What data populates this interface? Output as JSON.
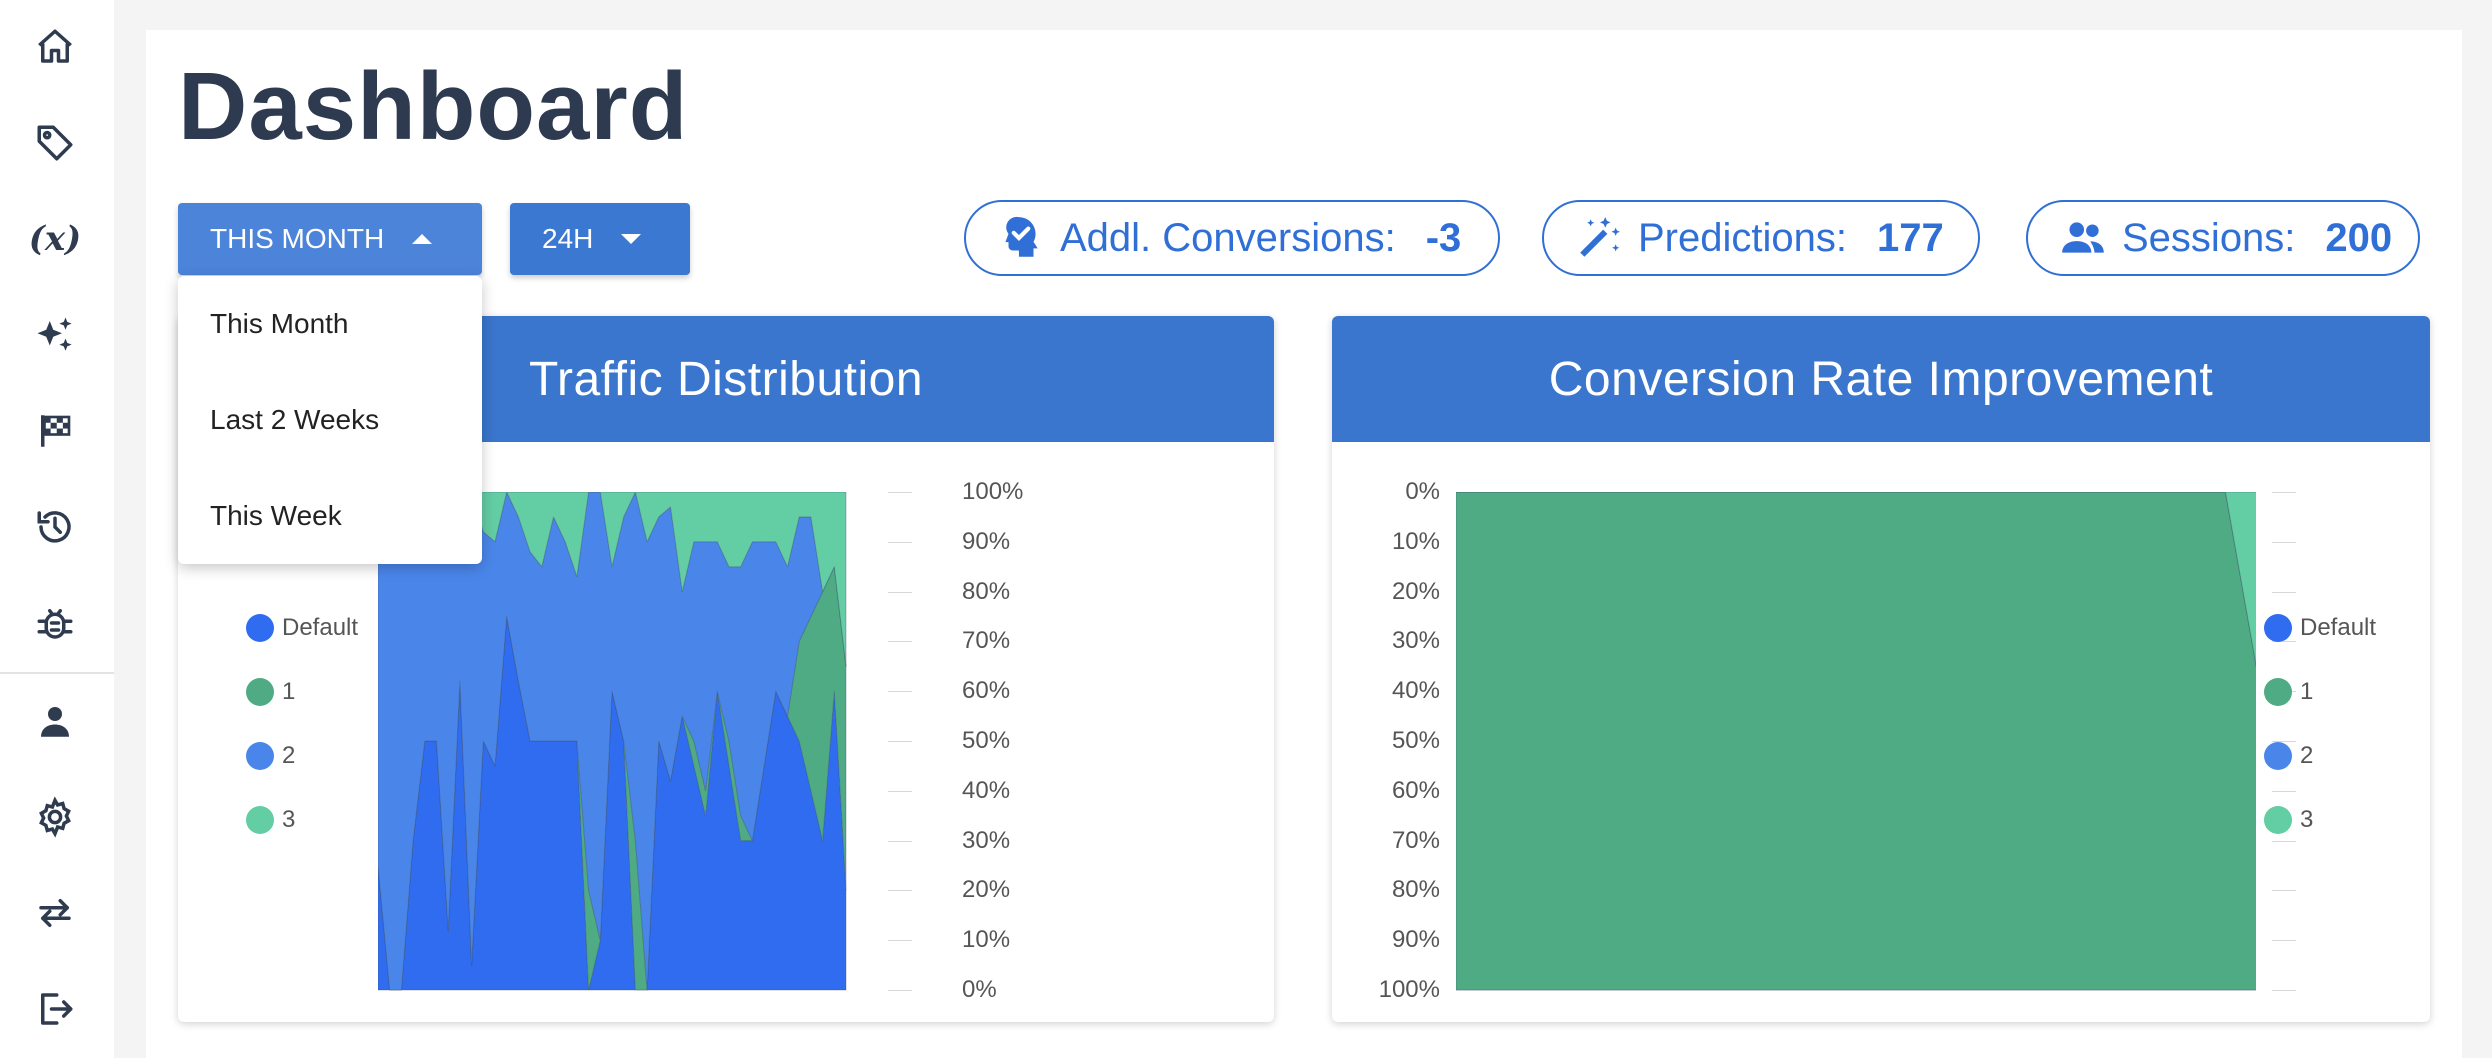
{
  "sidebar": {
    "items": [
      {
        "name": "home",
        "icon": "home-icon"
      },
      {
        "name": "tags",
        "icon": "tag-icon"
      },
      {
        "name": "variables",
        "icon": "fx-icon",
        "label": "(x)"
      },
      {
        "name": "ai",
        "icon": "sparkles-icon"
      },
      {
        "name": "goals",
        "icon": "flag-checkered-icon"
      },
      {
        "name": "history",
        "icon": "history-icon"
      },
      {
        "name": "debug",
        "icon": "bug-icon"
      },
      {
        "name": "account",
        "icon": "user-icon"
      },
      {
        "name": "settings",
        "icon": "gear-icon"
      },
      {
        "name": "switch",
        "icon": "swap-arrows-icon"
      },
      {
        "name": "logout",
        "icon": "logout-icon"
      }
    ]
  },
  "page": {
    "title": "Dashboard"
  },
  "filters": {
    "period": {
      "label": "THIS MONTH",
      "options": [
        "This Month",
        "Last 2 Weeks",
        "This Week"
      ]
    },
    "granularity": {
      "label": "24H"
    }
  },
  "stats": [
    {
      "label": "Addl. Conversions:",
      "value": "-3",
      "icon": "head-check-icon"
    },
    {
      "label": "Predictions:",
      "value": "177",
      "icon": "magic-wand-icon"
    },
    {
      "label": "Sessions:",
      "value": "200",
      "icon": "users-icon"
    }
  ],
  "colors": {
    "accent": "#3a76cd",
    "button": "#3b78d1",
    "button_active": "#4c84da",
    "series_default": "#2f6cf0",
    "series_1": "#4fab84",
    "series_2": "#4a86ea",
    "series_3": "#63cda3"
  },
  "charts": {
    "traffic": {
      "title": "Traffic Distribution"
    },
    "conversion": {
      "title": "Conversion Rate Improvement"
    }
  },
  "chart_data": [
    {
      "type": "area",
      "title": "Traffic Distribution",
      "stacked_percent": true,
      "legend": [
        "Default",
        "1",
        "2",
        "3"
      ],
      "legend_placement": "left",
      "y_axis_side": "right",
      "y_tick_labels": [
        "100%",
        "90%",
        "80%",
        "70%",
        "60%",
        "50%",
        "40%",
        "30%",
        "20%",
        "10%",
        "0%"
      ],
      "ylim": [
        0,
        100
      ],
      "x": [
        0,
        1,
        2,
        3,
        4,
        5,
        6,
        7,
        8,
        9,
        10,
        11,
        12,
        13,
        14,
        15,
        16,
        17,
        18,
        19,
        20,
        21,
        22,
        23,
        24,
        25,
        26,
        27,
        28,
        29,
        30,
        31,
        32,
        33,
        34,
        35,
        36,
        37,
        38,
        39,
        40
      ],
      "series": [
        {
          "name": "Default",
          "values": [
            25,
            0,
            0,
            30,
            50,
            50,
            12,
            62,
            5,
            50,
            45,
            75,
            62,
            50,
            50,
            50,
            50,
            50,
            0,
            10,
            60,
            50,
            0,
            0,
            50,
            42,
            55,
            45,
            35,
            60,
            45,
            30,
            30,
            45,
            60,
            55,
            50,
            40,
            30,
            60,
            20
          ]
        },
        {
          "name": "1",
          "values": [
            0,
            0,
            0,
            0,
            0,
            0,
            0,
            0,
            0,
            0,
            0,
            0,
            0,
            0,
            0,
            0,
            0,
            0,
            20,
            0,
            0,
            0,
            30,
            0,
            0,
            0,
            0,
            5,
            5,
            0,
            5,
            5,
            0,
            0,
            0,
            0,
            20,
            35,
            50,
            25,
            45
          ]
        },
        {
          "name": "2",
          "values": [
            75,
            100,
            100,
            70,
            50,
            50,
            88,
            38,
            95,
            42,
            45,
            25,
            33,
            38,
            35,
            45,
            40,
            33,
            80,
            90,
            25,
            45,
            70,
            90,
            45,
            55,
            25,
            40,
            50,
            30,
            35,
            50,
            60,
            45,
            30,
            30,
            25,
            20,
            0,
            0,
            0
          ]
        },
        {
          "name": "3",
          "values": [
            0,
            0,
            0,
            0,
            0,
            0,
            0,
            0,
            0,
            8,
            10,
            0,
            5,
            12,
            15,
            5,
            10,
            17,
            0,
            0,
            15,
            5,
            0,
            10,
            5,
            3,
            20,
            10,
            10,
            10,
            15,
            15,
            10,
            10,
            10,
            15,
            5,
            5,
            20,
            15,
            35
          ]
        }
      ]
    },
    {
      "type": "area",
      "title": "Conversion Rate Improvement",
      "stacked_percent": true,
      "legend": [
        "Default",
        "1",
        "2",
        "3"
      ],
      "legend_placement": "right",
      "y_axis_side": "left",
      "y_tick_labels": [
        "0%",
        "10%",
        "20%",
        "30%",
        "40%",
        "50%",
        "60%",
        "70%",
        "80%",
        "90%",
        "100%"
      ],
      "ylim": [
        0,
        100
      ],
      "x": [
        0,
        1,
        2,
        3,
        4,
        5,
        6,
        7,
        8,
        9,
        10,
        11,
        12,
        13,
        14,
        15,
        16,
        17,
        18,
        19,
        20
      ],
      "series": [
        {
          "name": "Default",
          "values": [
            0,
            0,
            0,
            0,
            0,
            0,
            0,
            0,
            0,
            0,
            0,
            0,
            0,
            0,
            0,
            0,
            0,
            0,
            0,
            0,
            0
          ]
        },
        {
          "name": "1",
          "values": [
            100,
            100,
            100,
            100,
            100,
            100,
            100,
            100,
            100,
            100,
            100,
            100,
            100,
            100,
            100,
            100,
            100,
            100,
            100,
            100,
            54
          ]
        },
        {
          "name": "2",
          "values": [
            0,
            0,
            0,
            0,
            0,
            0,
            0,
            0,
            0,
            0,
            0,
            0,
            0,
            0,
            0,
            0,
            0,
            0,
            0,
            0,
            0
          ]
        },
        {
          "name": "3",
          "values": [
            0,
            0,
            0,
            0,
            0,
            0,
            0,
            0,
            0,
            0,
            0,
            0,
            0,
            0,
            0,
            0,
            0,
            0,
            0,
            0,
            46
          ]
        }
      ]
    }
  ]
}
